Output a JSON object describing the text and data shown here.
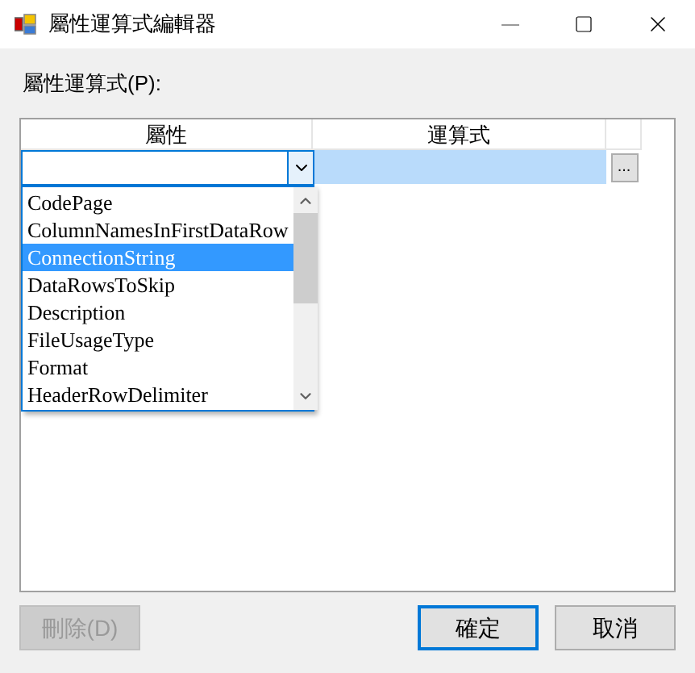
{
  "window": {
    "title": "屬性運算式編輯器"
  },
  "grid_label": "屬性運算式(P):",
  "table": {
    "columns": [
      "屬性",
      "運算式"
    ],
    "row": {
      "expression_selected": true,
      "ellipsis": "..."
    }
  },
  "dropdown": {
    "items": [
      {
        "label": "CodePage",
        "selected": false
      },
      {
        "label": "ColumnNamesInFirstDataRow",
        "selected": false
      },
      {
        "label": "ConnectionString",
        "selected": true
      },
      {
        "label": "DataRowsToSkip",
        "selected": false
      },
      {
        "label": "Description",
        "selected": false
      },
      {
        "label": "FileUsageType",
        "selected": false
      },
      {
        "label": "Format",
        "selected": false
      },
      {
        "label": "HeaderRowDelimiter",
        "selected": false
      }
    ]
  },
  "buttons": [
    {
      "label": "刪除(D)",
      "disabled": true,
      "default": false
    },
    {
      "label": "確定",
      "disabled": false,
      "default": true
    },
    {
      "label": "取消",
      "disabled": false,
      "default": false
    }
  ]
}
